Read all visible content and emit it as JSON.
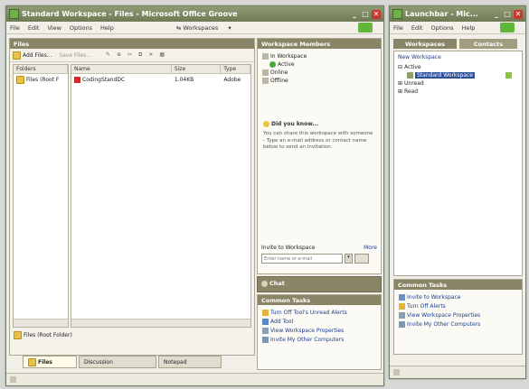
{
  "main_window": {
    "title": "Standard Workspace - Files - Microsoft Office Groove",
    "menu": [
      "File",
      "Edit",
      "View",
      "Options",
      "Help"
    ],
    "workspaces_menu": "Workspaces",
    "files_panel": {
      "header": "Files",
      "toolbar": {
        "add_files": "Add Files...",
        "save_files": "Save Files..."
      },
      "folders_column": "Folders",
      "folder_tree_item": "Files (Root F",
      "columns": [
        "Name",
        "Size",
        "Type"
      ],
      "rows": [
        {
          "name": "CodingStandDC",
          "size": "1.04KB",
          "type": "Adobe"
        }
      ],
      "root_folder_label": "Files (Root Folder)"
    },
    "tabs": [
      "Files",
      "Discussion",
      "Notepad"
    ],
    "members_panel": {
      "header": "Workspace Members",
      "groups": [
        "In Workspace",
        "Active",
        "Online",
        "Offline"
      ]
    },
    "did_you_know": {
      "title": "Did you know...",
      "text": "You can share this workspace with someone - Type an e-mail address or contact name below to send an invitation."
    },
    "invite": {
      "label": "Invite to Workspace",
      "more": "More",
      "placeholder": "Enter name or e-mail"
    },
    "chat": {
      "header": "Chat"
    },
    "common_tasks": {
      "header": "Common Tasks",
      "items": [
        "Turn Off Tool's Unread Alerts",
        "Add Tool",
        "View Workspace Properties",
        "Invite My Other Computers"
      ]
    }
  },
  "launchbar": {
    "title": "Launchbar - Mic...",
    "menu": [
      "File",
      "Edit",
      "Options",
      "Help"
    ],
    "tabs": [
      "Workspaces",
      "Contacts"
    ],
    "new_workspace": "New Workspace",
    "groups": [
      "Active",
      "Standard Workspace",
      "Unread",
      "Read"
    ],
    "common_tasks": {
      "header": "Common Tasks",
      "items": [
        "Invite to Workspace",
        "Turn Off Alerts",
        "View Workspace Properties",
        "Invite My Other Computers"
      ]
    }
  },
  "colors": {
    "title_bar": "#707a56",
    "panel_header": "#8a8566",
    "accent_green": "#62b63a"
  }
}
